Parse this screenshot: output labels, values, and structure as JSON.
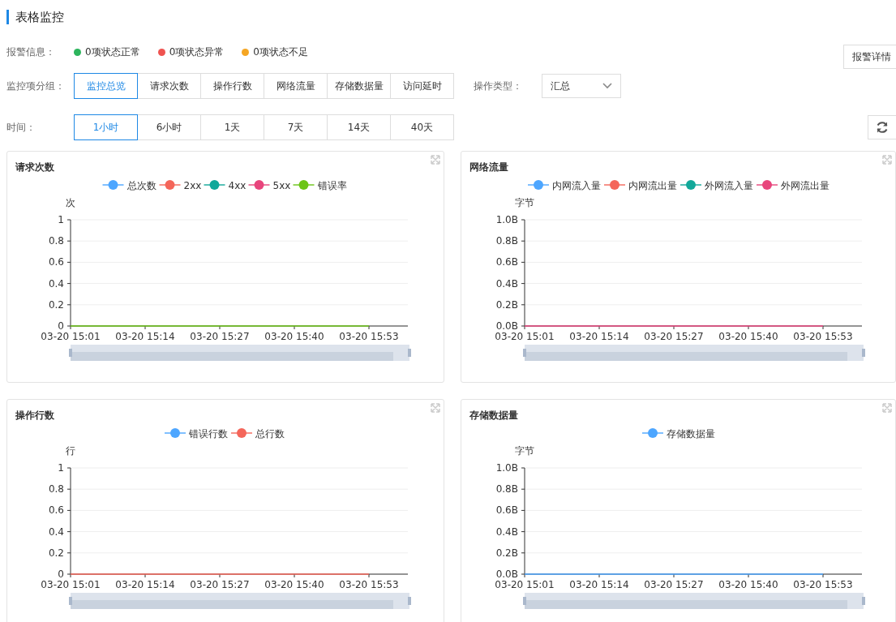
{
  "page_title": "表格监控",
  "alerts": {
    "label": "报警信息：",
    "items": [
      {
        "text": "0项状态正常",
        "color": "#2db55d"
      },
      {
        "text": "0项状态异常",
        "color": "#ef5350"
      },
      {
        "text": "0项状态不足",
        "color": "#f5a623"
      }
    ],
    "detail_button": "报警详情"
  },
  "group": {
    "label": "监控项分组：",
    "tabs": [
      {
        "label": "监控总览",
        "selected": true
      },
      {
        "label": "请求次数",
        "selected": false
      },
      {
        "label": "操作行数",
        "selected": false
      },
      {
        "label": "网络流量",
        "selected": false
      },
      {
        "label": "存储数据量",
        "selected": false
      },
      {
        "label": "访问延时",
        "selected": false
      }
    ]
  },
  "operation_type": {
    "label": "操作类型：",
    "value": "汇总"
  },
  "time": {
    "label": "时间：",
    "tabs": [
      {
        "label": "1小时",
        "selected": true
      },
      {
        "label": "6小时",
        "selected": false
      },
      {
        "label": "1天",
        "selected": false
      },
      {
        "label": "7天",
        "selected": false
      },
      {
        "label": "14天",
        "selected": false
      },
      {
        "label": "40天",
        "selected": false
      }
    ]
  },
  "charts": [
    {
      "title": "请求次数",
      "chart_data": {
        "type": "line",
        "ylabel": "次",
        "legend": "top",
        "grid": true,
        "ylim": [
          0,
          1
        ],
        "categories": [
          "03-20 15:01",
          "03-20 15:14",
          "03-20 15:27",
          "03-20 15:40",
          "03-20 15:53"
        ],
        "yticks": [
          {
            "value": 0,
            "label": "0"
          },
          {
            "value": 0.2,
            "label": "0.2"
          },
          {
            "value": 0.4,
            "label": "0.4"
          },
          {
            "value": 0.6,
            "label": "0.6"
          },
          {
            "value": 0.8,
            "label": "0.8"
          },
          {
            "value": 1,
            "label": "1"
          }
        ],
        "series": [
          {
            "name": "总次数",
            "color": "#4da6ff",
            "values": [
              null,
              null,
              null,
              null,
              null
            ]
          },
          {
            "name": "2xx",
            "color": "#f4665a",
            "values": [
              null,
              null,
              null,
              null,
              null
            ]
          },
          {
            "name": "4xx",
            "color": "#12a89a",
            "values": [
              null,
              null,
              null,
              null,
              null
            ]
          },
          {
            "name": "5xx",
            "color": "#e8457c",
            "values": [
              null,
              null,
              null,
              null,
              null
            ]
          },
          {
            "name": "错误率",
            "color": "#6cc417",
            "values": [
              0,
              0,
              0,
              0,
              0
            ]
          }
        ]
      }
    },
    {
      "title": "网络流量",
      "chart_data": {
        "type": "line",
        "ylabel": "字节",
        "legend": "top",
        "grid": true,
        "ylim": [
          0,
          1
        ],
        "categories": [
          "03-20 15:01",
          "03-20 15:14",
          "03-20 15:27",
          "03-20 15:40",
          "03-20 15:53"
        ],
        "yticks": [
          {
            "value": 0,
            "label": "0.0B"
          },
          {
            "value": 0.2,
            "label": "0.2B"
          },
          {
            "value": 0.4,
            "label": "0.4B"
          },
          {
            "value": 0.6,
            "label": "0.6B"
          },
          {
            "value": 0.8,
            "label": "0.8B"
          },
          {
            "value": 1,
            "label": "1.0B"
          }
        ],
        "series": [
          {
            "name": "内网流入量",
            "color": "#4da6ff",
            "values": [
              null,
              null,
              null,
              null,
              null
            ]
          },
          {
            "name": "内网流出量",
            "color": "#f4665a",
            "values": [
              null,
              null,
              null,
              null,
              null
            ]
          },
          {
            "name": "外网流入量",
            "color": "#12a89a",
            "values": [
              null,
              null,
              null,
              null,
              null
            ]
          },
          {
            "name": "外网流出量",
            "color": "#e8457c",
            "values": [
              0,
              0,
              0,
              0,
              0
            ]
          }
        ]
      }
    },
    {
      "title": "操作行数",
      "chart_data": {
        "type": "line",
        "ylabel": "行",
        "legend": "top",
        "grid": true,
        "ylim": [
          0,
          1
        ],
        "categories": [
          "03-20 15:01",
          "03-20 15:14",
          "03-20 15:27",
          "03-20 15:40",
          "03-20 15:53"
        ],
        "yticks": [
          {
            "value": 0,
            "label": "0"
          },
          {
            "value": 0.2,
            "label": "0.2"
          },
          {
            "value": 0.4,
            "label": "0.4"
          },
          {
            "value": 0.6,
            "label": "0.6"
          },
          {
            "value": 0.8,
            "label": "0.8"
          },
          {
            "value": 1,
            "label": "1"
          }
        ],
        "series": [
          {
            "name": "错误行数",
            "color": "#4da6ff",
            "values": [
              null,
              null,
              null,
              null,
              null
            ]
          },
          {
            "name": "总行数",
            "color": "#f4665a",
            "values": [
              0,
              0,
              0,
              0,
              0
            ]
          }
        ]
      }
    },
    {
      "title": "存储数据量",
      "chart_data": {
        "type": "line",
        "ylabel": "字节",
        "legend": "top",
        "grid": true,
        "ylim": [
          0,
          1
        ],
        "categories": [
          "03-20 15:01",
          "03-20 15:14",
          "03-20 15:27",
          "03-20 15:40",
          "03-20 15:53"
        ],
        "yticks": [
          {
            "value": 0,
            "label": "0.0B"
          },
          {
            "value": 0.2,
            "label": "0.2B"
          },
          {
            "value": 0.4,
            "label": "0.4B"
          },
          {
            "value": 0.6,
            "label": "0.6B"
          },
          {
            "value": 0.8,
            "label": "0.8B"
          },
          {
            "value": 1,
            "label": "1.0B"
          }
        ],
        "series": [
          {
            "name": "存储数据量",
            "color": "#4da6ff",
            "values": [
              0,
              0,
              0,
              0,
              0
            ]
          }
        ]
      }
    }
  ]
}
